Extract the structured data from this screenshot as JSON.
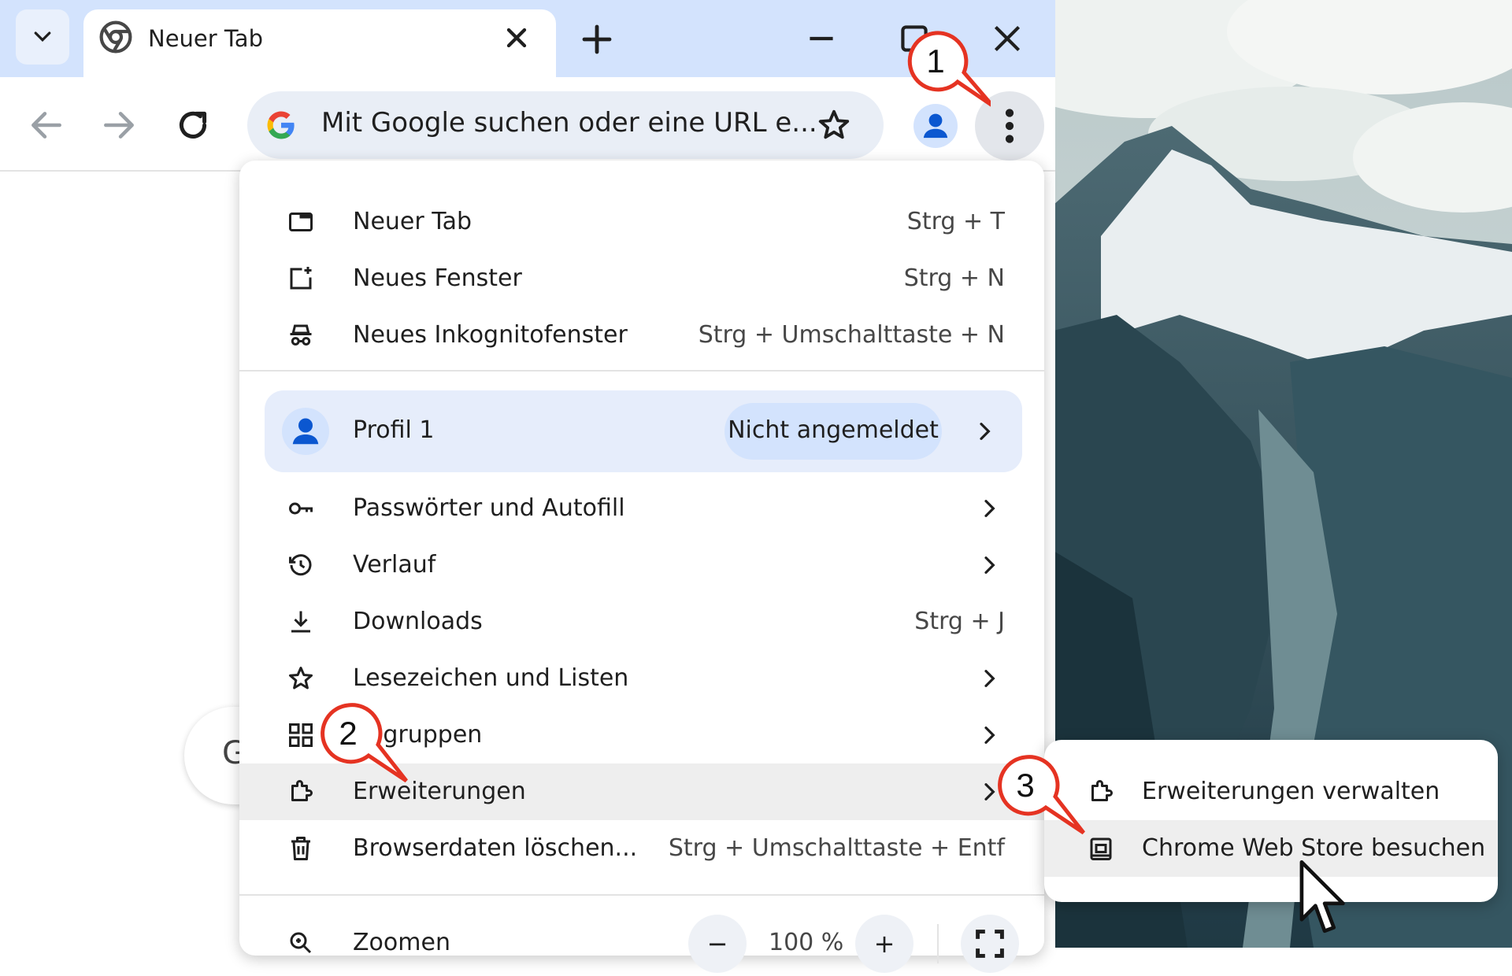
{
  "tab": {
    "title": "Neuer Tab"
  },
  "omnibox": {
    "placeholder": "Mit Google suchen oder eine URL e..."
  },
  "colors": {
    "accent_blue": "#0b57d0",
    "tabstrip": "#d3e3fd",
    "omnibox": "#e9eef6",
    "callout_red": "#e53322"
  },
  "menu": {
    "items": [
      {
        "label": "Neuer Tab",
        "shortcut": "Strg + T",
        "icon": "new-tab-icon"
      },
      {
        "label": "Neues Fenster",
        "shortcut": "Strg + N",
        "icon": "new-window-icon"
      },
      {
        "label": "Neues Inkognitofenster",
        "shortcut": "Strg + Umschalttaste + N",
        "icon": "incognito-icon"
      }
    ],
    "profile": {
      "label": "Profil 1",
      "status": "Nicht angemeldet"
    },
    "items2": [
      {
        "label": "Passwörter und Autofill",
        "icon": "key-icon"
      },
      {
        "label": "Verlauf",
        "icon": "history-icon"
      },
      {
        "label": "Downloads",
        "shortcut": "Strg + J",
        "icon": "download-icon"
      },
      {
        "label": "Lesezeichen und Listen",
        "icon": "star-icon"
      },
      {
        "label": "ogruppen",
        "icon": "grid-icon"
      },
      {
        "label": "Erweiterungen",
        "icon": "puzzle-icon"
      },
      {
        "label": "Browserdaten löschen...",
        "shortcut": "Strg + Umschalttaste + Entf",
        "icon": "trash-icon"
      }
    ],
    "zoom": {
      "label": "Zoomen",
      "value": "100 %",
      "minus": "−",
      "plus": "+"
    }
  },
  "submenu": {
    "items": [
      {
        "label": "Erweiterungen verwalten",
        "icon": "puzzle-icon"
      },
      {
        "label": "Chrome Web Store besuchen",
        "icon": "web-store-icon"
      }
    ]
  },
  "callouts": [
    "1",
    "2",
    "3"
  ],
  "page": {
    "search_fragment": "G"
  }
}
